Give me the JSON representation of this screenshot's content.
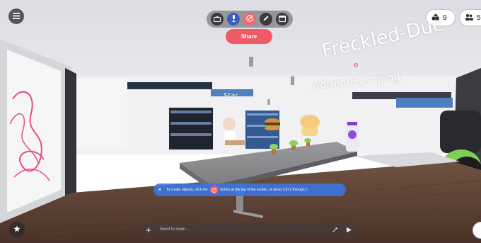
{
  "toolbar": {
    "items": [
      {
        "icon": "camera-icon",
        "active": false
      },
      {
        "icon": "microphone-icon",
        "active": false
      },
      {
        "icon": "create-object-icon",
        "active": true
      },
      {
        "icon": "pen-icon",
        "active": false
      },
      {
        "icon": "media-frame-icon",
        "active": false
      }
    ],
    "share_label": "Share"
  },
  "room_stats": {
    "objects_count": "9",
    "people_count": "5"
  },
  "scene": {
    "avatar_name": "Freckled-Duc",
    "admin_label": "Admin-Hyunjong",
    "star_label": "Star"
  },
  "hint": {
    "prefix": "To create objects, click the",
    "suffix": "button at the top of the screen, or press Ctrl 1 through 7."
  },
  "chat": {
    "placeholder": "Send to room..."
  },
  "colors": {
    "accent": "#ee5a66",
    "hint_bg": "#3a76e4",
    "hud_dark": "#2b2b30"
  }
}
